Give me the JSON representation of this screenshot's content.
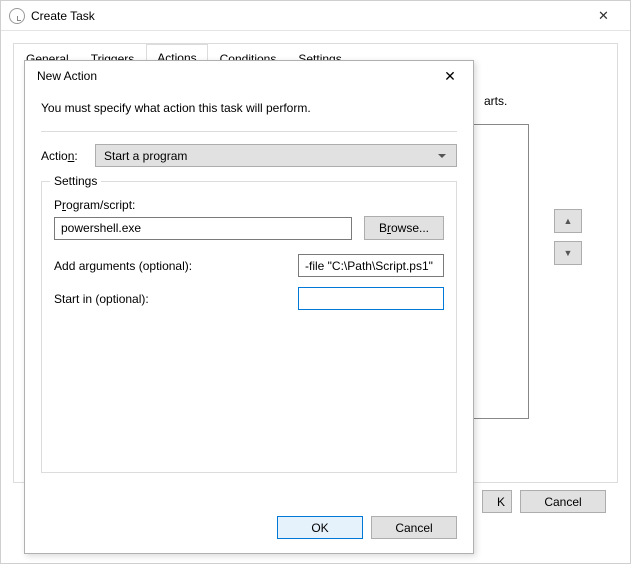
{
  "outer": {
    "title": "Create Task",
    "tabs": [
      "General",
      "Triggers",
      "Actions",
      "Conditions",
      "Settings"
    ],
    "active_tab": 2,
    "partial_text": "arts.",
    "ok_partial": "K",
    "ok": "OK",
    "cancel": "Cancel"
  },
  "inner": {
    "title": "New Action",
    "instruction": "You must specify what action this task will perform.",
    "action_label": "Action:",
    "action_value": "Start a program",
    "settings_legend": "Settings",
    "program_label_pre": "P",
    "program_label_ul": "r",
    "program_label_post": "ogram/script:",
    "program_value": "powershell.exe",
    "browse": "Browse...",
    "args_label_ul": "A",
    "args_label_post": "dd arguments (optional):",
    "args_value": "-file \"C:\\Path\\Script.ps1\"",
    "startin_label_pre": "Star",
    "startin_label_ul": "t",
    "startin_label_post": " in (optional):",
    "startin_value": "",
    "ok": "OK",
    "cancel": "Cancel"
  }
}
